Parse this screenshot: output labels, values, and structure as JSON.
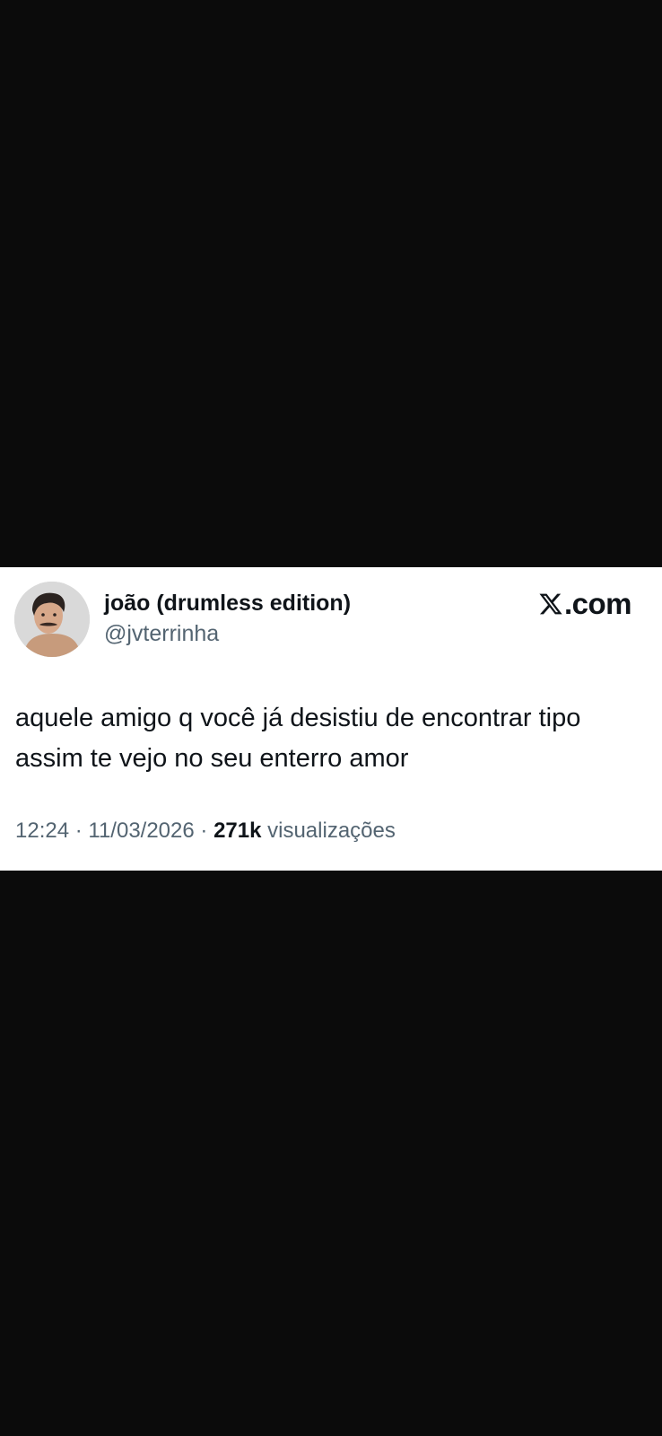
{
  "tweet": {
    "display_name": "joão (drumless edition)",
    "handle": "@jvterrinha",
    "brand_text": ".com",
    "brand_icon": "x-logo-icon",
    "text_line_1": "aquele amigo q você já desistiu de encontrar tipo",
    "text_line_2": "assim te vejo no seu enterro amor",
    "time": "12:24",
    "separator": " · ",
    "date": "11/03/2026",
    "views_count": "271k",
    "views_label": "visualizações"
  },
  "colors": {
    "background": "#0b0b0b",
    "card": "#ffffff",
    "text_primary": "#0f1419",
    "text_secondary": "#536471"
  }
}
